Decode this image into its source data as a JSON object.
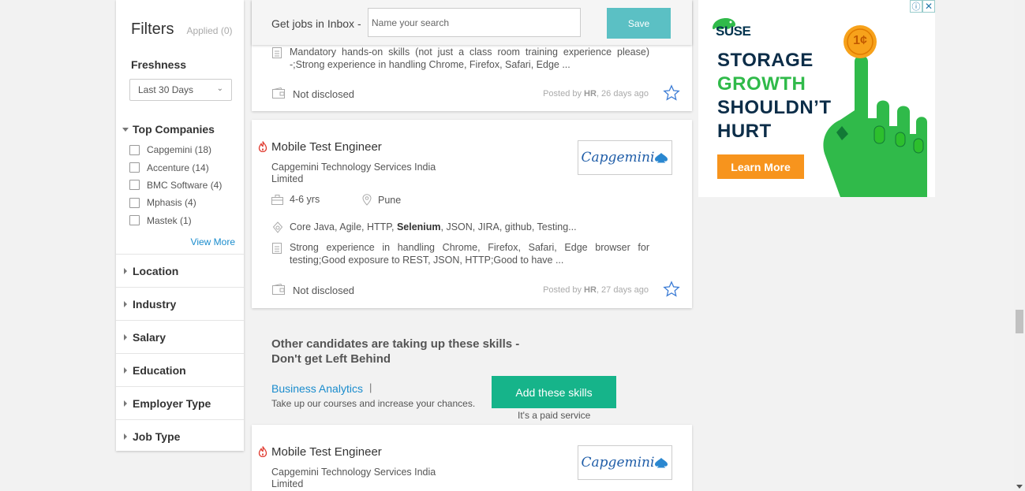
{
  "filters": {
    "title": "Filters",
    "applied": "Applied (0)",
    "freshness": {
      "title": "Freshness",
      "selected": "Last 30 Days"
    },
    "top_companies": {
      "title": "Top Companies",
      "items": [
        {
          "label": "Capgemini (18)"
        },
        {
          "label": "Accenture (14)"
        },
        {
          "label": "BMC Software (4)"
        },
        {
          "label": "Mphasis (4)"
        },
        {
          "label": "Mastek (1)"
        }
      ],
      "view_more": "View More"
    },
    "sections": [
      "Location",
      "Industry",
      "Salary",
      "Education",
      "Employer Type",
      "Job Type"
    ]
  },
  "save_search": {
    "label": "Get jobs in Inbox -",
    "placeholder": "Name your search",
    "button": "Save"
  },
  "jobs": [
    {
      "description": "Mandatory hands-on skills (not just a class room training experience please) -;Strong experience in handling Chrome, Firefox, Safari, Edge ...",
      "salary": "Not disclosed",
      "posted_prefix": "Posted by",
      "posted_by": "HR",
      "posted_when": ", 26 days ago"
    },
    {
      "title": "Mobile Test Engineer",
      "company": "Capgemini Technology Services India Limited",
      "logo": "Capgemini",
      "experience": "4-6 yrs",
      "location": "Pune",
      "skills_before": "Core Java, Agile, HTTP, ",
      "skills_bold": "Selenium",
      "skills_after": ", JSON, JIRA, github, Testing...",
      "description": "Strong experience in handling Chrome, Firefox, Safari, Edge browser for testing;Good exposure to REST, JSON, HTTP;Good to have ...",
      "salary": "Not disclosed",
      "posted_prefix": "Posted by",
      "posted_by": "HR",
      "posted_when": ", 27 days ago"
    },
    {
      "title": "Mobile Test Engineer",
      "company": "Capgemini Technology Services India Limited",
      "logo": "Capgemini"
    }
  ],
  "upskill": {
    "title": "Other candidates are taking up these skills - Don't get Left Behind",
    "skill": "Business Analytics",
    "separator": "|",
    "subtitle": "Take up our courses and increase your chances.",
    "button": "Add these skills",
    "note": "It's a paid service"
  },
  "ad": {
    "brand": "SUSE",
    "coin": "1¢",
    "lines": [
      "STORAGE",
      "GROWTH",
      "SHOULDN’T",
      "HURT"
    ],
    "cta": "Learn More",
    "info": "ⓘ",
    "close": "✕",
    "colors": {
      "green": "#30ba4a",
      "navy": "#0c2d48",
      "orange": "#f7941d"
    }
  }
}
